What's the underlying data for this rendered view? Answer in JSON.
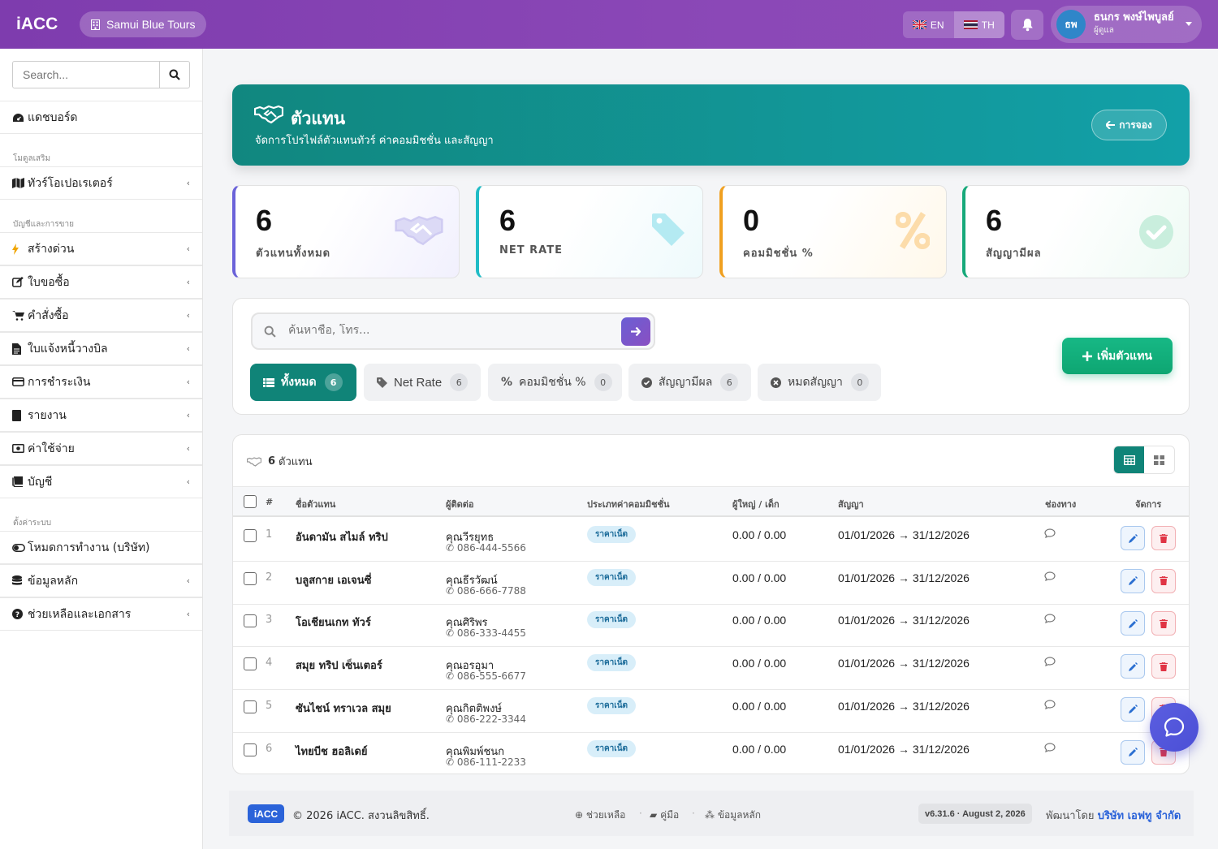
{
  "topbar": {
    "logo": "iACC",
    "company": "Samui Blue Tours",
    "lang_en": "EN",
    "lang_th": "TH",
    "user_initials": "ธพ",
    "user_name": "ธนกร พงษ์ไพบูลย์",
    "user_role": "ผู้ดูแล"
  },
  "sidebar": {
    "search_placeholder": "Search...",
    "dashboard": "แดชบอร์ด",
    "section_modules": "โมดูลเสริม",
    "tour_operator": "ทัวร์โอเปอเรเตอร์",
    "section_accounting": "บัญชีและการขาย",
    "quick_create": "สร้างด่วน",
    "quotation": "ใบขอซื้อ",
    "purchase_order": "คำสั่งซื้อ",
    "invoice": "ใบแจ้งหนี้วางบิล",
    "payment": "การชำระเงิน",
    "report": "รายงาน",
    "expense": "ค่าใช้จ่าย",
    "account": "บัญชี",
    "section_settings": "ตั้งค่าระบบ",
    "work_mode": "โหมดการทำงาน (บริษัท)",
    "master_data": "ข้อมูลหลัก",
    "help_docs": "ช่วยเหลือและเอกสาร"
  },
  "hero": {
    "title": "ตัวแทน",
    "subtitle": "จัดการโปรไฟล์ตัวแทนทัวร์ ค่าคอมมิชชั่น และสัญญา",
    "back_label": "การจอง"
  },
  "stats": [
    {
      "value": "6",
      "label": "ตัวแทนทั้งหมด"
    },
    {
      "value": "6",
      "label": "NET RATE"
    },
    {
      "value": "0",
      "label": "คอมมิชชั่น %"
    },
    {
      "value": "6",
      "label": "สัญญามีผล"
    }
  ],
  "filters": {
    "search_placeholder": "ค้นหาชื่อ, โทร...",
    "add_label": "เพิ่มตัวแทน",
    "chips": [
      {
        "label": "ทั้งหมด",
        "count": "6"
      },
      {
        "label": "Net Rate",
        "count": "6"
      },
      {
        "label": "คอมมิชชั่น %",
        "count": "0"
      },
      {
        "label": "สัญญามีผล",
        "count": "6"
      },
      {
        "label": "หมดสัญญา",
        "count": "0"
      }
    ]
  },
  "table": {
    "count_number": "6",
    "count_label": "ตัวแทน",
    "headers": {
      "no": "#",
      "name": "ชื่อตัวแทน",
      "contact": "ผู้ติดต่อ",
      "commission": "ประเภทค่าคอมมิชชั่น",
      "rate": "ผู้ใหญ่ / เด็ก",
      "contract": "สัญญา",
      "channel": "ช่องทาง",
      "actions": "จัดการ"
    },
    "rows": [
      {
        "no": "1",
        "name": "อันดามัน สไมล์ ทริป",
        "contact": "คุณวีรยุทธ",
        "phone": "086-444-5566",
        "type": "ราคาเน็ต",
        "rate": "0.00 / 0.00",
        "contract": "01/01/2026 → 31/12/2026"
      },
      {
        "no": "2",
        "name": "บลูสกาย เอเจนซี่",
        "contact": "คุณธีรวัฒน์",
        "phone": "086-666-7788",
        "type": "ราคาเน็ต",
        "rate": "0.00 / 0.00",
        "contract": "01/01/2026 → 31/12/2026"
      },
      {
        "no": "3",
        "name": "โอเชียนเกท ทัวร์",
        "contact": "คุณศิริพร",
        "phone": "086-333-4455",
        "type": "ราคาเน็ต",
        "rate": "0.00 / 0.00",
        "contract": "01/01/2026 → 31/12/2026"
      },
      {
        "no": "4",
        "name": "สมุย ทริป เซ็นเตอร์",
        "contact": "คุณอรอุมา",
        "phone": "086-555-6677",
        "type": "ราคาเน็ต",
        "rate": "0.00 / 0.00",
        "contract": "01/01/2026 → 31/12/2026"
      },
      {
        "no": "5",
        "name": "ซันไชน์ ทราเวล สมุย",
        "contact": "คุณกิตติพงษ์",
        "phone": "086-222-3344",
        "type": "ราคาเน็ต",
        "rate": "0.00 / 0.00",
        "contract": "01/01/2026 → 31/12/2026"
      },
      {
        "no": "6",
        "name": "ไทยบีช ฮอลิเดย์",
        "contact": "คุณพิมพ์ชนก",
        "phone": "086-111-2233",
        "type": "ราคาเน็ต",
        "rate": "0.00 / 0.00",
        "contract": "01/01/2026 → 31/12/2026"
      }
    ]
  },
  "footer": {
    "logo": "iACC",
    "copyright": "© 2026 iACC. สงวนลิขสิทธิ์.",
    "help": "ช่วยเหลือ",
    "manual": "คู่มือ",
    "master": "ข้อมูลหลัก",
    "version": "v6.31.6 · August 2, 2026",
    "dev_prefix": "พัฒนาโดย",
    "dev_name": "บริษัท เอฟทู จำกัด"
  },
  "colors": {
    "topbar": "#8a47b6",
    "hero": "#12929a",
    "primary_green": "#108478",
    "add_button": "#13b07c",
    "accent_blue": "#2b63d9"
  },
  "icons": [
    "search-icon",
    "bell-icon",
    "handshake-icon",
    "tag-icon",
    "percent-icon",
    "check-circle-icon",
    "arrow-right-icon",
    "arrow-left-icon",
    "plus-icon",
    "list-icon",
    "grid-icon",
    "table-icon",
    "chat-icon",
    "edit-icon",
    "trash-icon",
    "phone-icon"
  ]
}
